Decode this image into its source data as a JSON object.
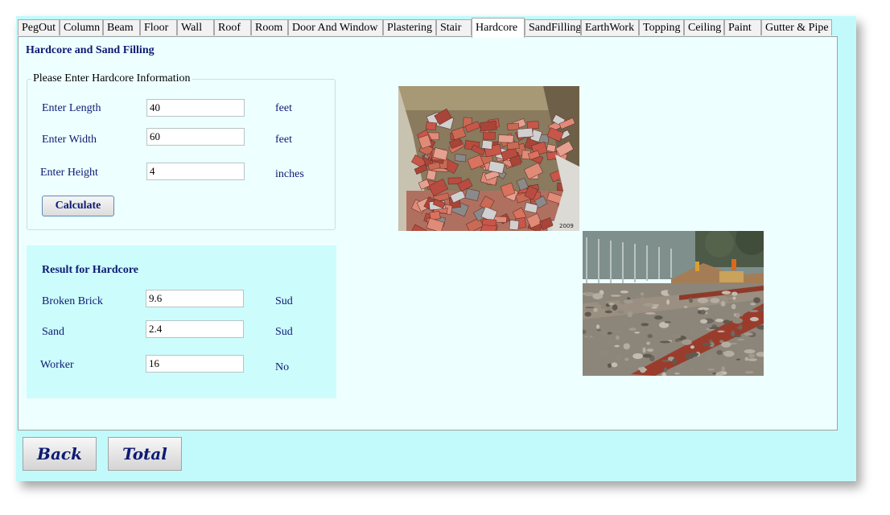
{
  "tabs": [
    "PegOut",
    "Column",
    "Beam",
    "Floor",
    "Wall",
    "Roof",
    "Room",
    "Door And Window",
    "Plastering",
    "Stair",
    "Hardcore",
    "SandFilling",
    "EarthWork",
    "Topping",
    "Ceiling",
    "Paint",
    "Gutter & Pipe"
  ],
  "active_tab": "Hardcore",
  "heading": "Hardcore  and  Sand Filling",
  "input_group": {
    "legend": "Please Enter Hardcore Information",
    "length": {
      "label": "Enter Length",
      "value": "40",
      "unit": "feet"
    },
    "width": {
      "label": "Enter Width",
      "value": "60",
      "unit": "feet"
    },
    "height": {
      "label": "Enter Height",
      "value": "4",
      "unit": "inches"
    },
    "calculate_label": "Calculate"
  },
  "result": {
    "title": "Result for Hardcore",
    "broken_brick": {
      "label": "Broken Brick",
      "value": "9.6",
      "unit": "Sud"
    },
    "sand": {
      "label": "Sand",
      "value": "2.4",
      "unit": "Sud"
    },
    "worker": {
      "label": "Worker",
      "value": "16",
      "unit": "No"
    }
  },
  "photos": {
    "bricks_caption": "2009"
  },
  "buttons": {
    "back": "Back",
    "total": "Total"
  }
}
